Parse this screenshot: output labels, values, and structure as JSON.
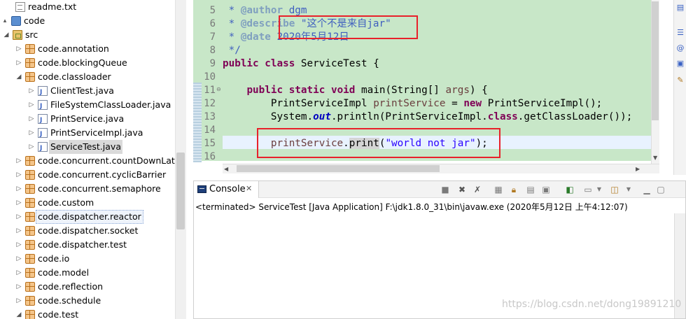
{
  "explorer": {
    "items": [
      {
        "label": "readme.txt",
        "icon": "text-file-icon",
        "indent": 1,
        "twist": ""
      },
      {
        "label": "code",
        "icon": "project-icon",
        "indent": 0,
        "twist": "▴"
      },
      {
        "label": "src",
        "icon": "source-folder-icon",
        "indent": 1,
        "twist": "◢"
      },
      {
        "label": "code.annotation",
        "icon": "package-icon",
        "indent": 2,
        "twist": "▷"
      },
      {
        "label": "code.blockingQueue",
        "icon": "package-icon",
        "indent": 2,
        "twist": "▷"
      },
      {
        "label": "code.classloader",
        "icon": "package-icon",
        "indent": 2,
        "twist": "◢"
      },
      {
        "label": "ClientTest.java",
        "icon": "java-file-icon",
        "indent": 3,
        "twist": "▷"
      },
      {
        "label": "FileSystemClassLoader.java",
        "icon": "java-file-icon",
        "indent": 3,
        "twist": "▷"
      },
      {
        "label": "PrintService.java",
        "icon": "java-file-icon",
        "indent": 3,
        "twist": "▷"
      },
      {
        "label": "PrintServiceImpl.java",
        "icon": "java-file-icon",
        "indent": 3,
        "twist": "▷"
      },
      {
        "label": "ServiceTest.java",
        "icon": "java-file-icon",
        "indent": 3,
        "twist": "▷",
        "state": "selected"
      },
      {
        "label": "code.concurrent.countDownLatch",
        "icon": "package-icon",
        "indent": 2,
        "twist": "▷"
      },
      {
        "label": "code.concurrent.cyclicBarrier",
        "icon": "package-icon",
        "indent": 2,
        "twist": "▷"
      },
      {
        "label": "code.concurrent.semaphore",
        "icon": "package-icon",
        "indent": 2,
        "twist": "▷"
      },
      {
        "label": "code.custom",
        "icon": "package-icon",
        "indent": 2,
        "twist": "▷"
      },
      {
        "label": "code.dispatcher.reactor",
        "icon": "package-icon",
        "indent": 2,
        "twist": "▷",
        "state": "hover"
      },
      {
        "label": "code.dispatcher.socket",
        "icon": "package-icon",
        "indent": 2,
        "twist": "▷"
      },
      {
        "label": "code.dispatcher.test",
        "icon": "package-icon",
        "indent": 2,
        "twist": "▷"
      },
      {
        "label": "code.io",
        "icon": "package-icon",
        "indent": 2,
        "twist": "▷"
      },
      {
        "label": "code.model",
        "icon": "package-icon",
        "indent": 2,
        "twist": "▷"
      },
      {
        "label": "code.reflection",
        "icon": "package-icon",
        "indent": 2,
        "twist": "▷"
      },
      {
        "label": "code.schedule",
        "icon": "package-icon",
        "indent": 2,
        "twist": "▷"
      },
      {
        "label": "code.test",
        "icon": "package-icon",
        "indent": 2,
        "twist": "◢"
      }
    ]
  },
  "editor": {
    "lines": [
      {
        "n": "5",
        "html": "<span class='cm'> * </span><span class='tag'>@author</span><span class='cm'> dgm</span>"
      },
      {
        "n": "6",
        "html": "<span class='cm'> * </span><span class='tag'>@describe</span><span class='cm'> \"这个不是来自jar\"</span>"
      },
      {
        "n": "7",
        "html": "<span class='cm'> * </span><span class='tag'>@date</span><span class='cm'> 2020年5月12日</span>"
      },
      {
        "n": "8",
        "html": "<span class='cm'> */</span>"
      },
      {
        "n": "9",
        "html": "<span class='kw'>public</span> <span class='kw'>class</span> ServiceTest {"
      },
      {
        "n": "10",
        "html": ""
      },
      {
        "n": "11",
        "html": "    <span class='kw'>public</span> <span class='kw'>static</span> <span class='kw'>void</span> main(String[] <span class='var'>args</span>) {"
      },
      {
        "n": "12",
        "html": "        PrintServiceImpl <span class='var'>printService</span> = <span class='kw'>new</span> PrintServiceImpl();"
      },
      {
        "n": "13",
        "html": "        System.<span class='fld'>out</span>.println(PrintServiceImpl.<span class='kw'>class</span>.getClassLoader());"
      },
      {
        "n": "14",
        "html": ""
      },
      {
        "n": "15",
        "html": "        <span class='var'>printService</span>.<span class='hl'>print</span>(<span class='str'>\"world not jar\"</span>);"
      },
      {
        "n": "16",
        "html": ""
      }
    ]
  },
  "console": {
    "tab_label": "Console",
    "close_glyph": "✕",
    "status": "<terminated> ServiceTest [Java Application] F:\\jdk1.8.0_31\\bin\\javaw.exe (2020年5月12日 上午4:12:07)",
    "watermark": "https://blog.csdn.net/dong19891210"
  },
  "colors": {
    "comment": "#3f5fbf",
    "keyword": "#7f0055",
    "string": "#2a00ff",
    "highlight_box": "#e8212b",
    "editor_bg": "#c8e7c8"
  }
}
